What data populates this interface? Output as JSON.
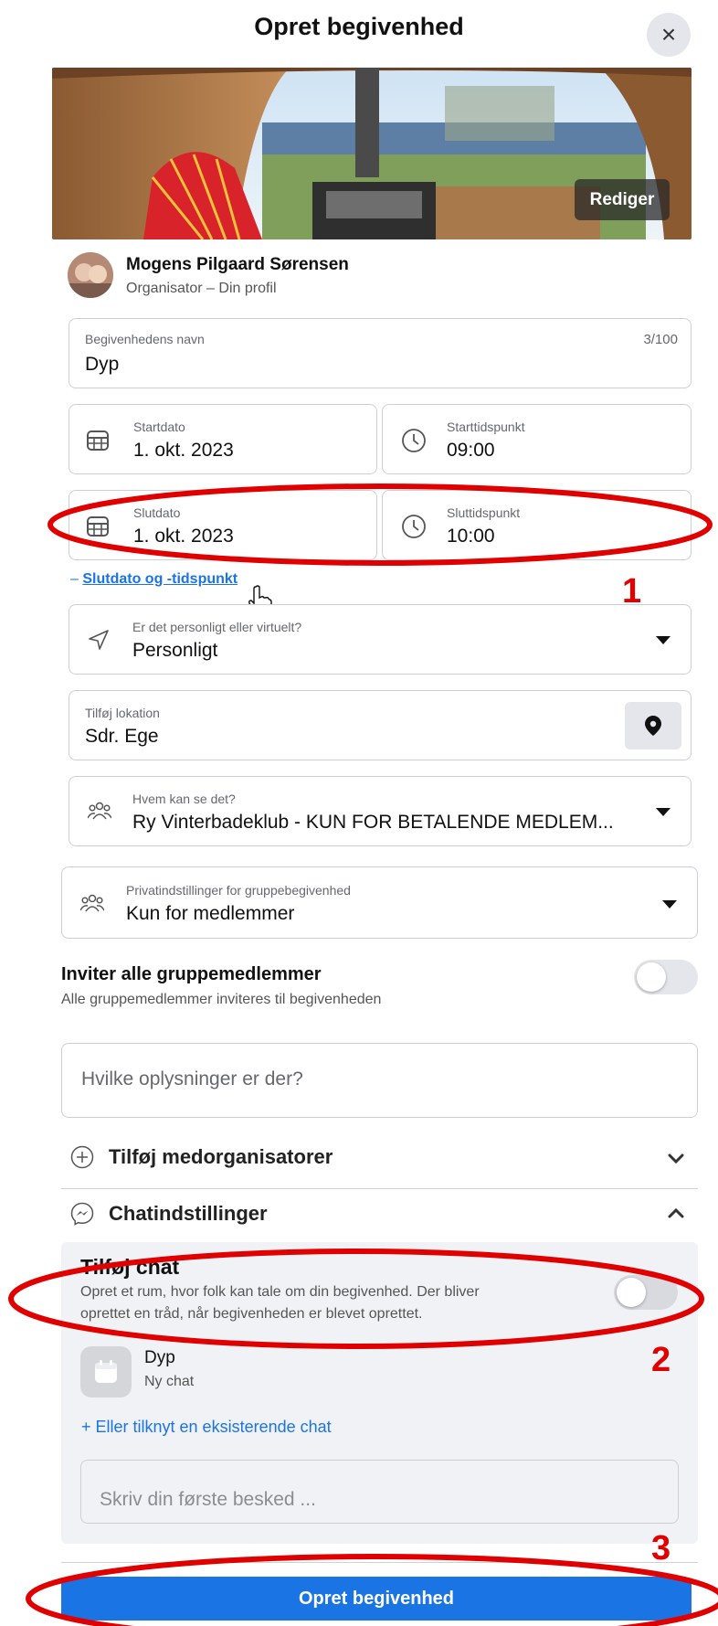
{
  "header": {
    "title": "Opret begivenhed",
    "close_symbol": "×"
  },
  "cover": {
    "edit_label": "Rediger"
  },
  "organizer": {
    "name": "Mogens Pilgaard Sørensen",
    "subtitle": "Organisator – Din profil"
  },
  "event_name": {
    "label": "Begivenhedens navn",
    "value": "Dyp",
    "counter": "3/100"
  },
  "start_date": {
    "label": "Startdato",
    "value": "1. okt. 2023"
  },
  "start_time": {
    "label": "Starttidspunkt",
    "value": "09:00"
  },
  "end_date": {
    "label": "Slutdato",
    "value": "1. okt. 2023"
  },
  "end_time": {
    "label": "Sluttidspunkt",
    "value": "10:00"
  },
  "end_toggle_link": {
    "prefix": "–",
    "label": "Slutdato og -tidspunkt"
  },
  "event_type": {
    "label": "Er det personligt eller virtuelt?",
    "value": "Personligt"
  },
  "location": {
    "label": "Tilføj lokation",
    "value": "Sdr. Ege"
  },
  "visibility": {
    "label": "Hvem kan se det?",
    "value": "Ry Vinterbadeklub - KUN FOR BETALENDE MEDLEM..."
  },
  "privacy": {
    "label": "Privatindstillinger for gruppebegivenhed",
    "value": "Kun for medlemmer"
  },
  "invite_all": {
    "title": "Inviter alle gruppemedlemmer",
    "subtitle": "Alle gruppemedlemmer inviteres til begivenheden",
    "enabled": false
  },
  "details": {
    "placeholder": "Hvilke oplysninger er der?"
  },
  "co_organizers": {
    "label": "Tilføj medorganisatorer"
  },
  "chat_settings": {
    "label": "Chatindstillinger",
    "add_chat_title": "Tilføj chat",
    "add_chat_desc_line1": "Opret et rum, hvor folk kan tale om din begivenhed. Der bliver",
    "add_chat_desc_line2": "oprettet en tråd, når begivenheden er blevet oprettet.",
    "add_chat_enabled": false,
    "chat_name": "Dyp",
    "chat_sub": "Ny chat",
    "link_existing": "+ Eller tilknyt en eksisterende chat",
    "message_placeholder": "Skriv din første besked ..."
  },
  "submit": {
    "label": "Opret begivenhed"
  },
  "annotations": {
    "n1": "1",
    "n2": "2",
    "n3": "3",
    "color": "#e00000"
  },
  "colors": {
    "primary": "#1b74e4",
    "annotation": "#e00000"
  }
}
